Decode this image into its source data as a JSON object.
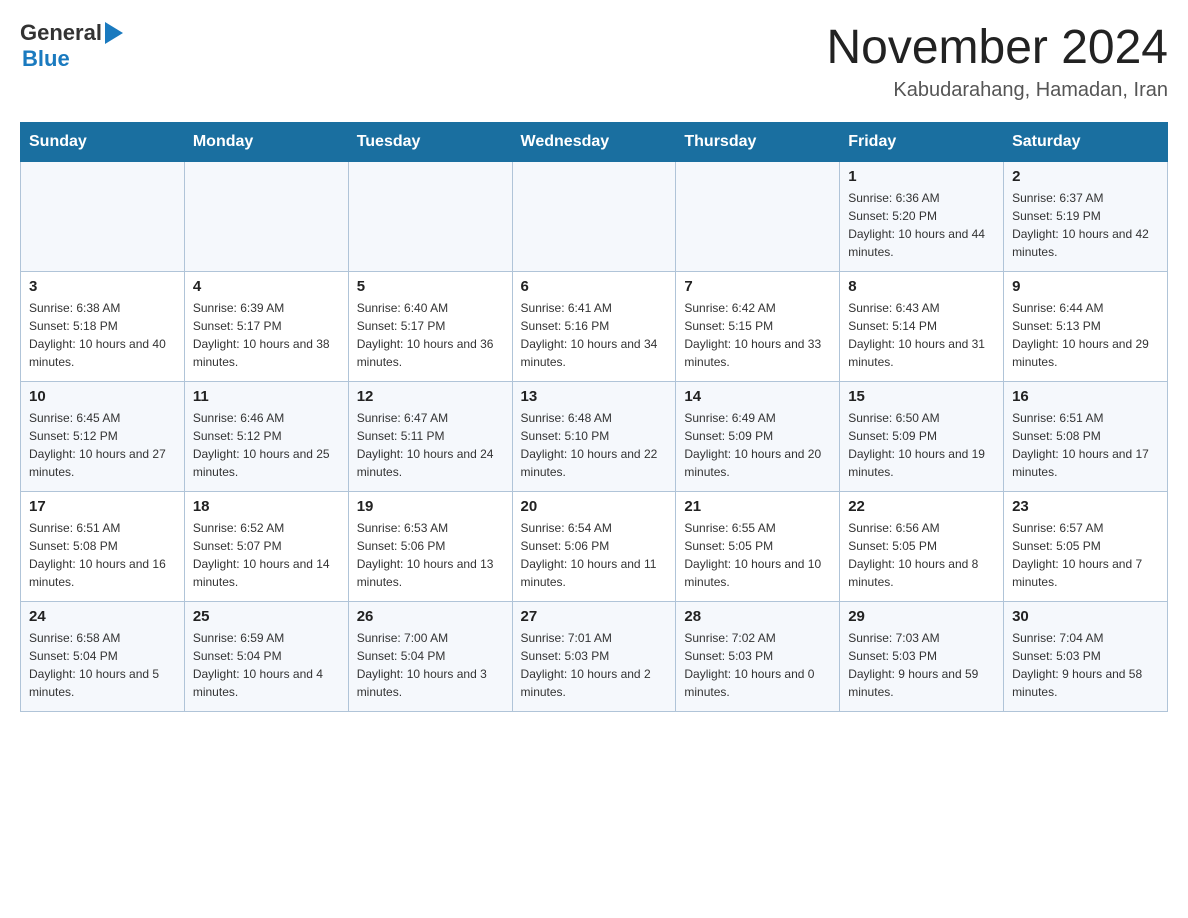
{
  "header": {
    "logo_general": "General",
    "logo_blue": "Blue",
    "month_title": "November 2024",
    "location": "Kabudarahang, Hamadan, Iran"
  },
  "days_of_week": [
    "Sunday",
    "Monday",
    "Tuesday",
    "Wednesday",
    "Thursday",
    "Friday",
    "Saturday"
  ],
  "weeks": [
    [
      {
        "day": "",
        "info": ""
      },
      {
        "day": "",
        "info": ""
      },
      {
        "day": "",
        "info": ""
      },
      {
        "day": "",
        "info": ""
      },
      {
        "day": "",
        "info": ""
      },
      {
        "day": "1",
        "info": "Sunrise: 6:36 AM\nSunset: 5:20 PM\nDaylight: 10 hours and 44 minutes."
      },
      {
        "day": "2",
        "info": "Sunrise: 6:37 AM\nSunset: 5:19 PM\nDaylight: 10 hours and 42 minutes."
      }
    ],
    [
      {
        "day": "3",
        "info": "Sunrise: 6:38 AM\nSunset: 5:18 PM\nDaylight: 10 hours and 40 minutes."
      },
      {
        "day": "4",
        "info": "Sunrise: 6:39 AM\nSunset: 5:17 PM\nDaylight: 10 hours and 38 minutes."
      },
      {
        "day": "5",
        "info": "Sunrise: 6:40 AM\nSunset: 5:17 PM\nDaylight: 10 hours and 36 minutes."
      },
      {
        "day": "6",
        "info": "Sunrise: 6:41 AM\nSunset: 5:16 PM\nDaylight: 10 hours and 34 minutes."
      },
      {
        "day": "7",
        "info": "Sunrise: 6:42 AM\nSunset: 5:15 PM\nDaylight: 10 hours and 33 minutes."
      },
      {
        "day": "8",
        "info": "Sunrise: 6:43 AM\nSunset: 5:14 PM\nDaylight: 10 hours and 31 minutes."
      },
      {
        "day": "9",
        "info": "Sunrise: 6:44 AM\nSunset: 5:13 PM\nDaylight: 10 hours and 29 minutes."
      }
    ],
    [
      {
        "day": "10",
        "info": "Sunrise: 6:45 AM\nSunset: 5:12 PM\nDaylight: 10 hours and 27 minutes."
      },
      {
        "day": "11",
        "info": "Sunrise: 6:46 AM\nSunset: 5:12 PM\nDaylight: 10 hours and 25 minutes."
      },
      {
        "day": "12",
        "info": "Sunrise: 6:47 AM\nSunset: 5:11 PM\nDaylight: 10 hours and 24 minutes."
      },
      {
        "day": "13",
        "info": "Sunrise: 6:48 AM\nSunset: 5:10 PM\nDaylight: 10 hours and 22 minutes."
      },
      {
        "day": "14",
        "info": "Sunrise: 6:49 AM\nSunset: 5:09 PM\nDaylight: 10 hours and 20 minutes."
      },
      {
        "day": "15",
        "info": "Sunrise: 6:50 AM\nSunset: 5:09 PM\nDaylight: 10 hours and 19 minutes."
      },
      {
        "day": "16",
        "info": "Sunrise: 6:51 AM\nSunset: 5:08 PM\nDaylight: 10 hours and 17 minutes."
      }
    ],
    [
      {
        "day": "17",
        "info": "Sunrise: 6:51 AM\nSunset: 5:08 PM\nDaylight: 10 hours and 16 minutes."
      },
      {
        "day": "18",
        "info": "Sunrise: 6:52 AM\nSunset: 5:07 PM\nDaylight: 10 hours and 14 minutes."
      },
      {
        "day": "19",
        "info": "Sunrise: 6:53 AM\nSunset: 5:06 PM\nDaylight: 10 hours and 13 minutes."
      },
      {
        "day": "20",
        "info": "Sunrise: 6:54 AM\nSunset: 5:06 PM\nDaylight: 10 hours and 11 minutes."
      },
      {
        "day": "21",
        "info": "Sunrise: 6:55 AM\nSunset: 5:05 PM\nDaylight: 10 hours and 10 minutes."
      },
      {
        "day": "22",
        "info": "Sunrise: 6:56 AM\nSunset: 5:05 PM\nDaylight: 10 hours and 8 minutes."
      },
      {
        "day": "23",
        "info": "Sunrise: 6:57 AM\nSunset: 5:05 PM\nDaylight: 10 hours and 7 minutes."
      }
    ],
    [
      {
        "day": "24",
        "info": "Sunrise: 6:58 AM\nSunset: 5:04 PM\nDaylight: 10 hours and 5 minutes."
      },
      {
        "day": "25",
        "info": "Sunrise: 6:59 AM\nSunset: 5:04 PM\nDaylight: 10 hours and 4 minutes."
      },
      {
        "day": "26",
        "info": "Sunrise: 7:00 AM\nSunset: 5:04 PM\nDaylight: 10 hours and 3 minutes."
      },
      {
        "day": "27",
        "info": "Sunrise: 7:01 AM\nSunset: 5:03 PM\nDaylight: 10 hours and 2 minutes."
      },
      {
        "day": "28",
        "info": "Sunrise: 7:02 AM\nSunset: 5:03 PM\nDaylight: 10 hours and 0 minutes."
      },
      {
        "day": "29",
        "info": "Sunrise: 7:03 AM\nSunset: 5:03 PM\nDaylight: 9 hours and 59 minutes."
      },
      {
        "day": "30",
        "info": "Sunrise: 7:04 AM\nSunset: 5:03 PM\nDaylight: 9 hours and 58 minutes."
      }
    ]
  ]
}
